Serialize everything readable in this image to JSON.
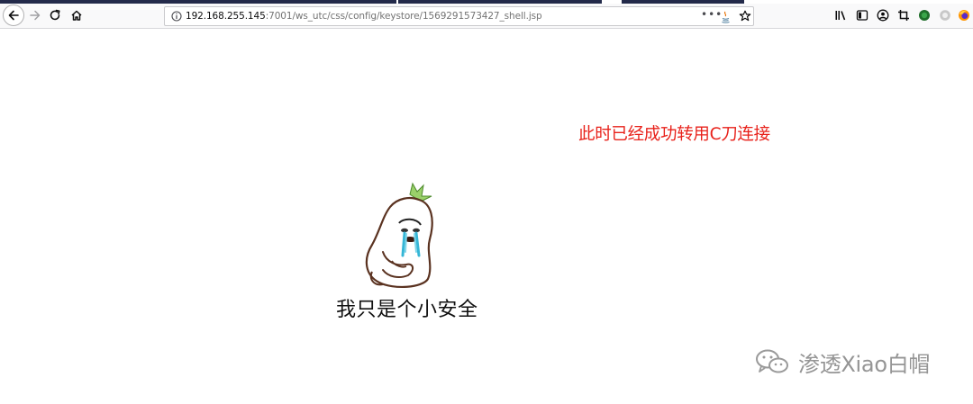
{
  "browser": {
    "url": {
      "host": "192.168.255.145",
      "rest": ":7001/ws_utc/css/config/keystore/1569291573427_shell.jsp"
    },
    "icons": {
      "back": "back-arrow-icon",
      "forward": "forward-arrow-icon",
      "reload": "reload-icon",
      "home": "home-icon",
      "info": "info-icon",
      "page_actions": "more-dots-icon",
      "java": "java-icon",
      "bookmark": "star-icon",
      "library": "library-icon",
      "sidebar": "sidebar-icon",
      "account": "account-icon",
      "crop": "screenshot-icon",
      "ext_green": "extension-green-icon",
      "ext_gray": "extension-gray-icon",
      "firefox": "firefox-icon"
    },
    "page_actions_label": "•••"
  },
  "content": {
    "red_caption": "此时已经成功转用C刀连接",
    "meme_caption": "我只是个小安全",
    "watermark": "渗透Xiao白帽"
  },
  "colors": {
    "red_caption": "#e8221b",
    "tab_strip": "#232a4a",
    "watermark": "#8a8a8a"
  }
}
